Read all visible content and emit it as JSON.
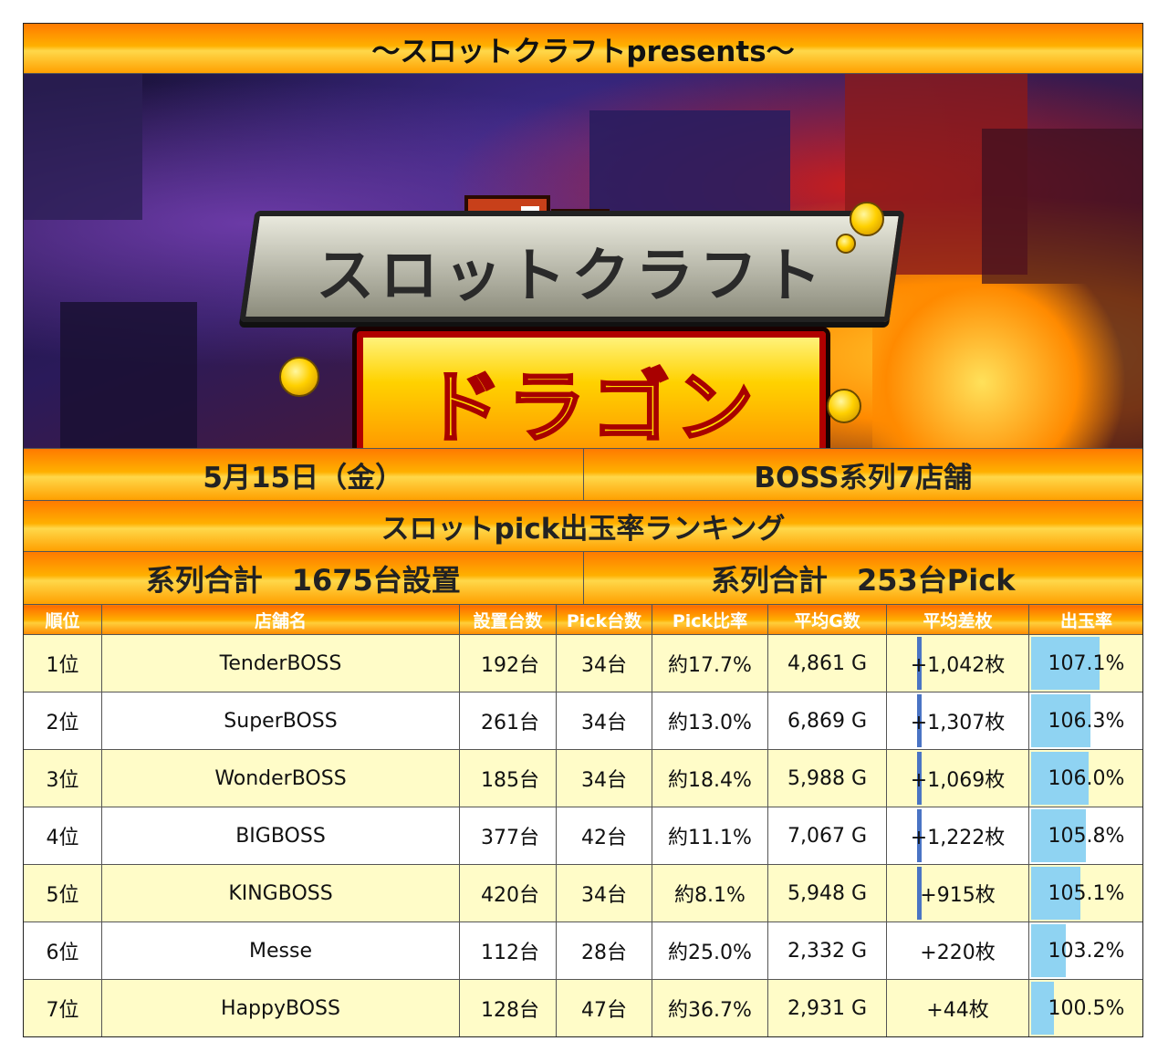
{
  "title": "～スロットクラフトpresents～",
  "banner": {
    "logo_line1": "スロットクラフト",
    "logo_line2": "ドラゴン"
  },
  "info": {
    "date": "5月15日（金）",
    "group": "BOSS系列7店舗"
  },
  "ranking_title": "スロットpick出玉率ランキング",
  "totals": {
    "installed": "系列合計　1675台設置",
    "picked": "系列合計　253台Pick"
  },
  "table": {
    "headers": [
      "順位",
      "店舗名",
      "設置台数",
      "Pick台数",
      "Pick比率",
      "平均G数",
      "平均差枚",
      "出玉率"
    ],
    "rows": [
      {
        "rank": "1位",
        "store": "TenderBOSS",
        "installed": "192台",
        "pick": "34台",
        "ratio": "約17.7%",
        "games": "4,861 G",
        "diff": "+1,042枚",
        "rate": "107.1%",
        "rate_fill": 0.6,
        "diff_bar": true
      },
      {
        "rank": "2位",
        "store": "SuperBOSS",
        "installed": "261台",
        "pick": "34台",
        "ratio": "約13.0%",
        "games": "6,869 G",
        "diff": "+1,307枚",
        "rate": "106.3%",
        "rate_fill": 0.52,
        "diff_bar": true
      },
      {
        "rank": "3位",
        "store": "WonderBOSS",
        "installed": "185台",
        "pick": "34台",
        "ratio": "約18.4%",
        "games": "5,988 G",
        "diff": "+1,069枚",
        "rate": "106.0%",
        "rate_fill": 0.5,
        "diff_bar": true
      },
      {
        "rank": "4位",
        "store": "BIGBOSS",
        "installed": "377台",
        "pick": "42台",
        "ratio": "約11.1%",
        "games": "7,067 G",
        "diff": "+1,222枚",
        "rate": "105.8%",
        "rate_fill": 0.48,
        "diff_bar": true
      },
      {
        "rank": "5位",
        "store": "KINGBOSS",
        "installed": "420台",
        "pick": "34台",
        "ratio": "約8.1%",
        "games": "5,948 G",
        "diff": "+915枚",
        "rate": "105.1%",
        "rate_fill": 0.43,
        "diff_bar": true
      },
      {
        "rank": "6位",
        "store": "Messe",
        "installed": "112台",
        "pick": "28台",
        "ratio": "約25.0%",
        "games": "2,332 G",
        "diff": "+220枚",
        "rate": "103.2%",
        "rate_fill": 0.3,
        "diff_bar": false
      },
      {
        "rank": "7位",
        "store": "HappyBOSS",
        "installed": "128台",
        "pick": "47台",
        "ratio": "約36.7%",
        "games": "2,931 G",
        "diff": "+44枚",
        "rate": "100.5%",
        "rate_fill": 0.2,
        "diff_bar": false
      }
    ]
  },
  "colors": {
    "band_orange": "#ff8a00",
    "row_yellow": "#fffcc8",
    "rate_bar": "#8fd3f2",
    "diff_bar": "#4a74c4"
  }
}
